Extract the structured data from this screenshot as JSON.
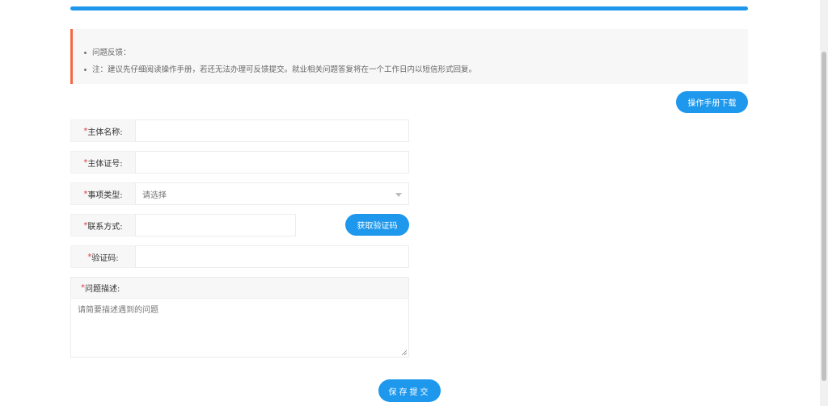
{
  "notice": {
    "items": [
      "问题反馈：",
      "注：建议先仔细阅读操作手册，若还无法办理可反馈提交。就业相关问题答复将在一个工作日内以短信形式回复。"
    ]
  },
  "buttons": {
    "manual_download": "操作手册下载",
    "get_code": "获取验证码",
    "submit": "保存提交"
  },
  "form": {
    "required_mark": "*",
    "entity_name": {
      "label": "主体名称:",
      "value": ""
    },
    "entity_id": {
      "label": "主体证号:",
      "value": ""
    },
    "matter_type": {
      "label": "事项类型:",
      "selected": "请选择"
    },
    "contact": {
      "label": "联系方式:",
      "value": ""
    },
    "verify_code": {
      "label": "验证码:",
      "value": ""
    },
    "description": {
      "label": "问题描述:",
      "placeholder": "请简要描述遇到的问题"
    }
  },
  "colors": {
    "accent": "#1d98ed",
    "notice_border": "#f26a45",
    "required": "#e4393c"
  }
}
